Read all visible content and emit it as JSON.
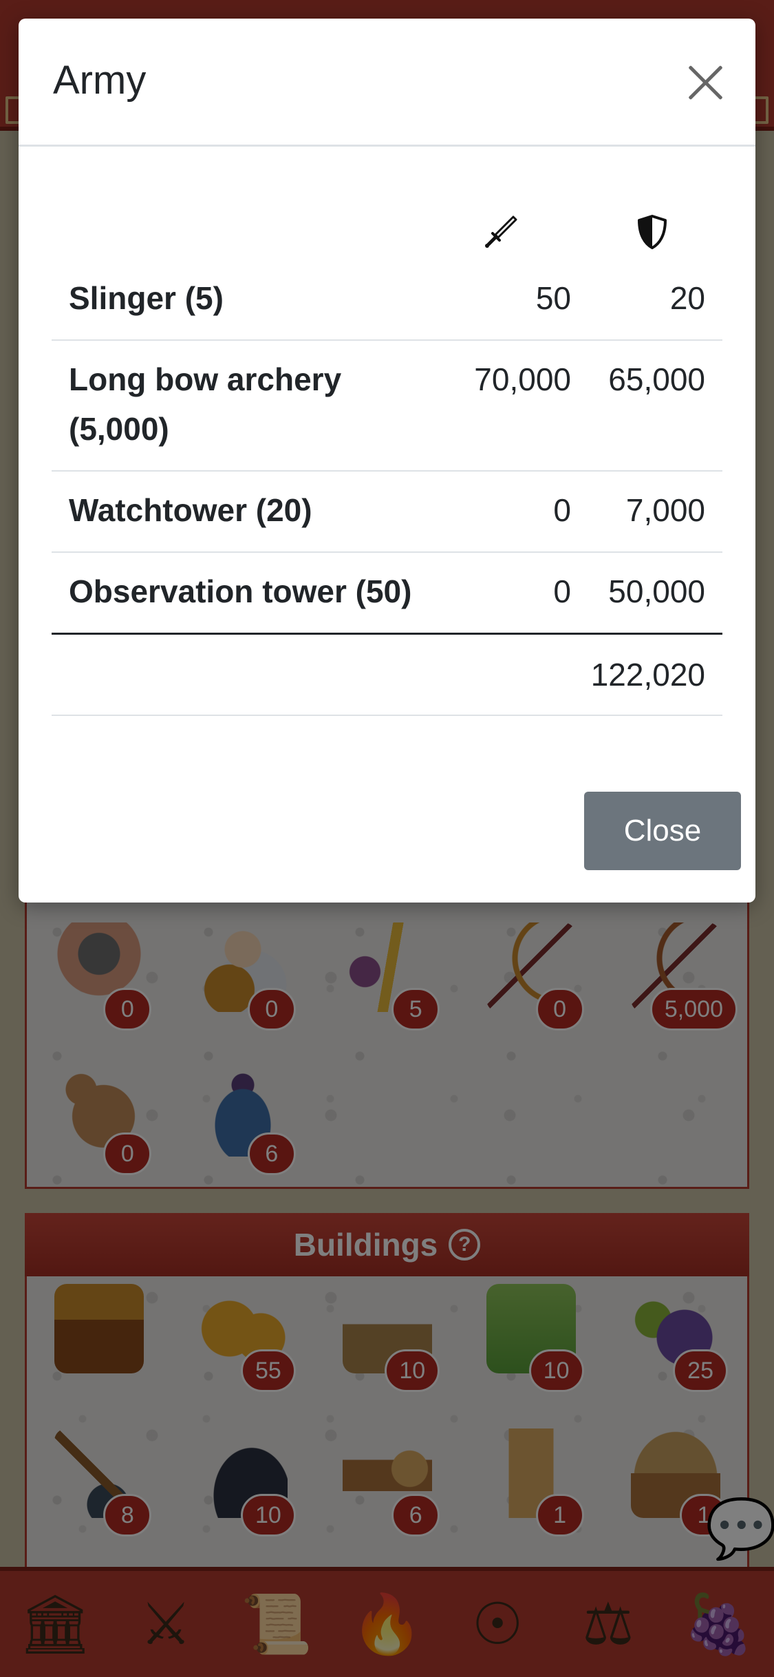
{
  "modal": {
    "title": "Army",
    "close_button_label": "Close",
    "columns": [
      {
        "icon": "sword-icon"
      },
      {
        "icon": "shield-icon"
      }
    ],
    "rows": [
      {
        "name": "Slinger (5)",
        "attack": "50",
        "defense": "20"
      },
      {
        "name": "Long bow archery (5,000)",
        "attack": "70,000",
        "defense": "65,000"
      },
      {
        "name": "Watchtower (20)",
        "attack": "0",
        "defense": "7,000"
      },
      {
        "name": "Observation tower (50)",
        "attack": "0",
        "defense": "50,000"
      }
    ],
    "total_defense": "122,020"
  },
  "army_panel": {
    "units": [
      {
        "icon": "hoplite-icon",
        "count": "0"
      },
      {
        "icon": "shield-bearer-icon",
        "count": "0"
      },
      {
        "icon": "slingshot-icon",
        "count": "5"
      },
      {
        "icon": "bow-icon",
        "count": "0"
      },
      {
        "icon": "longbow-icon",
        "count": "5,000"
      },
      {
        "icon": "horse-icon",
        "count": "0"
      },
      {
        "icon": "cloak-icon",
        "count": "6"
      }
    ]
  },
  "buildings_panel": {
    "title": "Buildings",
    "items": [
      {
        "icon": "treasure-chest-icon",
        "count": ""
      },
      {
        "icon": "gold-coins-icon",
        "count": "55"
      },
      {
        "icon": "well-icon",
        "count": "10"
      },
      {
        "icon": "farm-field-icon",
        "count": "10"
      },
      {
        "icon": "vineyard-icon",
        "count": "25"
      },
      {
        "icon": "pickaxe-icon",
        "count": "8"
      },
      {
        "icon": "mine-icon",
        "count": "10"
      },
      {
        "icon": "lumber-icon",
        "count": "6"
      },
      {
        "icon": "shrine-icon",
        "count": "1"
      },
      {
        "icon": "hut-icon",
        "count": "1"
      }
    ]
  },
  "bottom_nav": [
    {
      "icon": "temple-icon"
    },
    {
      "icon": "crossed-swords-icon"
    },
    {
      "icon": "scroll-icon"
    },
    {
      "icon": "torch-icon"
    },
    {
      "icon": "spartan-shield-icon"
    },
    {
      "icon": "scales-icon"
    },
    {
      "icon": "cornucopia-icon"
    }
  ],
  "colors": {
    "brand_red": "#b23a2e",
    "badge_red": "#b32a22",
    "close_button_gray": "#6c757d"
  }
}
